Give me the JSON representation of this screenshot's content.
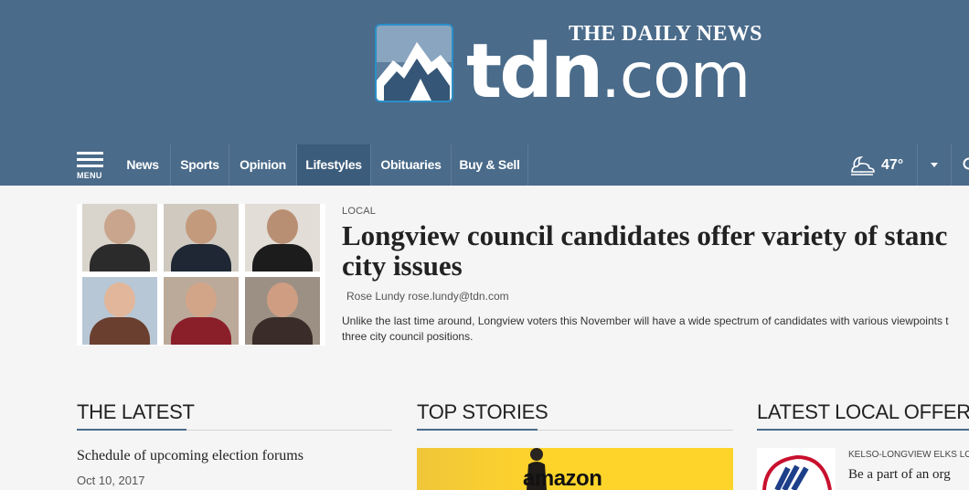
{
  "brand": {
    "tagline": "THE DAILY NEWS",
    "wordmark_bold": "tdn",
    "wordmark_light": ".com"
  },
  "nav": {
    "menu_label": "MENU",
    "items": [
      {
        "label": "News"
      },
      {
        "label": "Sports"
      },
      {
        "label": "Opinion"
      },
      {
        "label": "Lifestyles",
        "active": true
      },
      {
        "label": "Obituaries"
      },
      {
        "label": "Buy & Sell"
      }
    ],
    "weather": {
      "temp": "47°",
      "icon": "partly-cloudy-night-icon"
    }
  },
  "feature": {
    "kicker": "LOCAL",
    "headline_line1": "Longview council candidates offer variety of stanc",
    "headline_line2": "city issues",
    "byline": "Rose Lundy rose.lundy@tdn.com",
    "summary_line1": "Unlike the last time around, Longview voters this November will have a wide spectrum of candidates with various viewpoints t",
    "summary_line2": "three city council positions."
  },
  "sections": {
    "latest": {
      "title": "THE LATEST",
      "items": [
        {
          "title": "Schedule of upcoming election forums",
          "date": "Oct 10, 2017"
        }
      ]
    },
    "top_stories": {
      "title": "TOP STORIES",
      "image_text": "amazon"
    },
    "offers": {
      "title": "LATEST LOCAL OFFERS",
      "items": [
        {
          "kicker": "KELSO-LONGVIEW ELKS LO",
          "title": "Be a part of an org"
        }
      ]
    }
  },
  "colors": {
    "header_bg": "#4a6b8a",
    "nav_active_bg": "#3c5c7b",
    "page_bg": "#f5f5f5"
  }
}
